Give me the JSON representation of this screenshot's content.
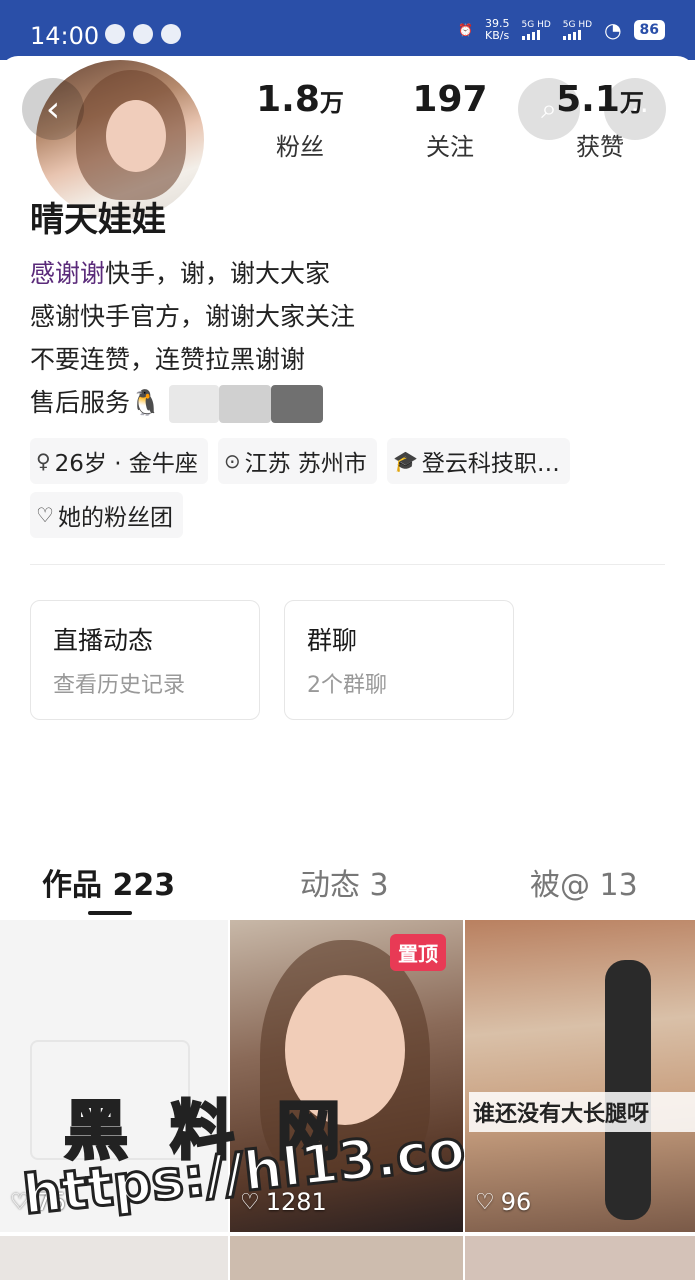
{
  "status_bar": {
    "time": "14:00",
    "net_speed_value": "39.5",
    "net_speed_unit": "KB/s",
    "sim1": "5G HD",
    "sim2": "5G HD",
    "battery": "86"
  },
  "profile": {
    "nickname": "晴天娃娃",
    "stats": [
      {
        "value": "1.8",
        "unit": "万",
        "label": "粉丝"
      },
      {
        "value": "197",
        "unit": "",
        "label": "关注"
      },
      {
        "value": "5.1",
        "unit": "万",
        "label": "获赞"
      }
    ],
    "bio": {
      "line1_hl": "感谢谢",
      "line1_rest": "快手，谢，谢大大家",
      "line2": "感谢快手官方，谢谢大家关注",
      "line3": "不要连赞，连赞拉黑谢谢",
      "line4": "售后服务🐧"
    },
    "tags": [
      {
        "icon": "female-icon",
        "text": "26岁 · 金牛座"
      },
      {
        "icon": "location-icon",
        "text": "江苏 苏州市"
      },
      {
        "icon": "school-icon",
        "text": "登云科技职…"
      }
    ],
    "fan_group": "她的粉丝团"
  },
  "features": [
    {
      "title": "直播动态",
      "subtitle": "查看历史记录"
    },
    {
      "title": "群聊",
      "subtitle": "2个群聊"
    }
  ],
  "tabs": [
    {
      "label": "作品 223"
    },
    {
      "label": "动态 3"
    },
    {
      "label": "被@ 13"
    }
  ],
  "videos": [
    {
      "likes": "75",
      "caption": "",
      "pinned": ""
    },
    {
      "likes": "1281",
      "caption": "",
      "pinned": "置顶"
    },
    {
      "likes": "96",
      "caption": "谁还没有大长腿呀",
      "pinned": ""
    }
  ],
  "watermark": {
    "title": "黑 料 网",
    "url": "https://hl13.co"
  },
  "colors": {
    "status_bar": "#2a4fa8",
    "pin_badge": "#e83a55",
    "bio_highlight": "#5a2a7a"
  }
}
